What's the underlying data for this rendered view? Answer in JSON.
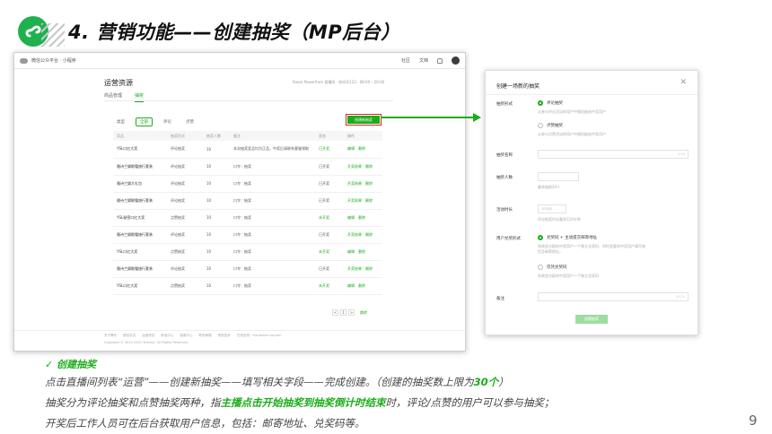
{
  "slide": {
    "title": "4. 营销功能——创建抽奖（MP后台）",
    "page_number": "9",
    "section_title": "✓  创建抽奖",
    "line1_a": "点击直播间列表“运营”——创建新抽奖——填写相关字段——完成创建。（创建的抽奖数上限为",
    "line1_em": "30个",
    "line1_b": "）",
    "line2_a": "抽奖分为评论抽奖和点赞抽奖两种，指",
    "line2_em": "主播点击开始抽奖到抽奖倒计时结束",
    "line2_b": "时，评论/点赞的用户可以参与抽奖；",
    "line3": "开奖后工作人员可在后台获取用户信息，包括：邮寄地址、兑奖码等。",
    "colors": {
      "brand_green": "#1aad19",
      "logo_green": "#20b14f",
      "highlight_red": "#e02020"
    }
  },
  "screen": {
    "topbar": {
      "brand": "微信公众平台 · 小程序",
      "link1": "社区",
      "link2": "文档"
    },
    "title": "运营资源",
    "meta": "Room Powerfrom 直播间 · 房间号123 · 08:00 – 20:00",
    "tabs": [
      "商品管理",
      "抽奖"
    ],
    "active_tab": 1,
    "filter": {
      "label": "类型",
      "chips": [
        "全部",
        "评论",
        "点赞"
      ]
    },
    "create_button": "创建新抽奖",
    "columns": [
      "奖品",
      "抽奖形式",
      "抽奖人数",
      "备注",
      "状态",
      "操作"
    ],
    "rows": [
      {
        "prize": "YSL口红大奖",
        "form": "评论抽奖",
        "count": "10",
        "note": "本次抽奖奖品均为正品，中奖后请联系客服领取",
        "status": "已开奖",
        "status_green": true,
        "act1": "编辑",
        "act2": "删除"
      },
      {
        "prize": "雅诗兰黛眼霜旅行套装",
        "form": "评论抽奖",
        "count": "10",
        "note": "口令：抽奖",
        "status": "已开奖",
        "status_green": false,
        "act1": "开奖结果",
        "act2": "删除"
      },
      {
        "prize": "雅诗兰黛大礼包",
        "form": "评论抽奖",
        "count": "10",
        "note": "口令：抽奖",
        "status": "已开奖",
        "status_green": false,
        "act1": "开奖结果",
        "act2": "删除"
      },
      {
        "prize": "雅诗兰黛眼霜旅行套装",
        "form": "评论抽奖",
        "count": "10",
        "note": "口令：抽奖",
        "status": "已开奖",
        "status_green": false,
        "act1": "开奖结果",
        "act2": "删除"
      },
      {
        "prize": "YSL秘密口红大奖",
        "form": "点赞抽奖",
        "count": "10",
        "note": "口令：抽奖",
        "status": "未开奖",
        "status_green": true,
        "act1": "编辑",
        "act2": "删除"
      },
      {
        "prize": "雅诗兰黛眼霜旅行套装",
        "form": "评论抽奖",
        "count": "10",
        "note": "口令：抽奖",
        "status": "已开奖",
        "status_green": false,
        "act1": "开奖结果",
        "act2": "删除"
      },
      {
        "prize": "YSL口红大奖",
        "form": "点赞抽奖",
        "count": "10",
        "note": "口令：抽奖",
        "status": "未开奖",
        "status_green": true,
        "act1": "编辑",
        "act2": "删除"
      },
      {
        "prize": "雅诗兰黛眼霜旅行套装",
        "form": "评论抽奖",
        "count": "10",
        "note": "口令：抽奖",
        "status": "已开奖",
        "status_green": false,
        "act1": "开奖结果",
        "act2": "删除"
      },
      {
        "prize": "YSL口红大奖",
        "form": "点赞抽奖",
        "count": "10",
        "note": "口令：抽奖",
        "status": "未开奖",
        "status_green": true,
        "act1": "编辑",
        "act2": "删除"
      }
    ],
    "pager": {
      "prev": "<",
      "page": "1",
      "next": ">",
      "go": "跳转"
    },
    "footer_links": [
      "关于腾讯",
      "服务协议",
      "运营规范",
      "辟谣中心",
      "客服中心",
      "联系邮箱",
      "侵权投诉",
      "在线反馈：mp.weixin.qq.com"
    ],
    "copyright": "Copyright © 2012-2020 Tencent. All Rights Reserved."
  },
  "dialog": {
    "title": "创建一场新的抽奖",
    "close": "✕",
    "form_label": "抽奖形式",
    "opt_comment": "评论抽奖",
    "opt_comment_hint": "从参与评论活动的用户中随机抽选中奖用户",
    "opt_like": "点赞抽奖",
    "opt_like_hint": "从参与点赞活动的用户中随机抽选中奖用户",
    "name_label": "抽奖名称",
    "name_counter": "0/16",
    "count_label": "抽奖人数",
    "count_hint": "最多抽取20人",
    "duration_label": "活动时长",
    "duration_placeholder": "10分钟",
    "duration_hint": "评论抽奖时长最多120分钟",
    "redeem_label": "用户兑奖形式",
    "opt_address": "兑奖码 + 主动提交邮寄地址",
    "opt_address_hint1": "系统会分配给中奖用户一个独立兑奖码，同时会要求中奖用户填写收",
    "opt_address_hint2": "货及邮寄地址。",
    "opt_code": "仅凭兑奖码",
    "opt_code_hint": "系统会分配给中奖用户一个独立兑奖码",
    "note_label": "备注",
    "note_counter": "0/120",
    "submit": "创建抽奖"
  }
}
